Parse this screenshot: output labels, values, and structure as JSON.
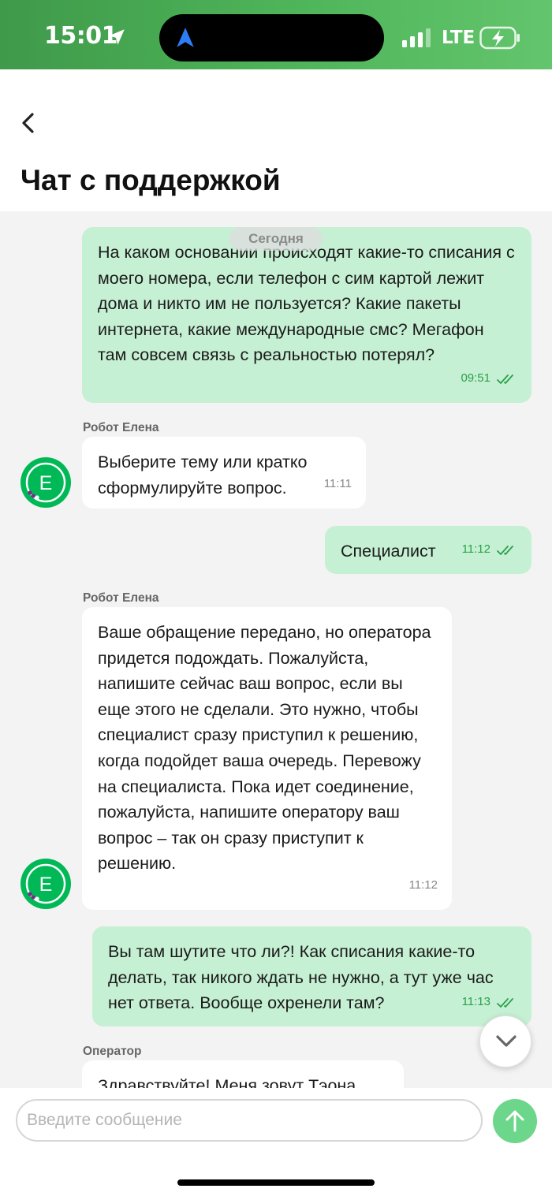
{
  "status_bar": {
    "time": "15:01",
    "network": "LTE"
  },
  "header": {
    "title": "Чат с поддержкой"
  },
  "chat": {
    "date_label": "Сегодня",
    "messages": [
      {
        "sender": "",
        "text": "На каком основании происходят какие-то списания с моего номера, если телефон с сим картой лежит дома и никто им не пользуется? Какие пакеты интернета, какие международные смс? Мегафон там совсем связь с реальностью потерял?",
        "time": "09:51",
        "read": true
      },
      {
        "sender": "Робот Елена",
        "text": "Выберите тему или кратко сформулируйте вопрос.",
        "time": "11:11",
        "avatar_letter": "Е"
      },
      {
        "sender": "",
        "text": "Специалист",
        "time": "11:12",
        "read": true
      },
      {
        "sender": "Робот Елена",
        "text": "Ваше обращение передано, но оператора придется подождать. Пожалуйста, напишите сейчас ваш вопрос, если вы еще этого не сделали. Это нужно, чтобы специалист сразу приступил к решению, когда подойдет ваша очередь. Перевожу на специалиста. Пока идет соединение, пожалуйста, напишите оператору ваш вопрос – так он сразу приступит к решению.",
        "time": "11:12",
        "avatar_letter": "Е"
      },
      {
        "sender": "",
        "text": "Вы там шутите что ли?! Как списания какие-то делать, так никого ждать не нужно, а тут уже час нет ответа. Вообще охренели там?",
        "time": "11:13",
        "read": true
      },
      {
        "sender": "Оператор",
        "text": "Здравствуйте! Меня зовут Тэона."
      }
    ]
  },
  "composer": {
    "placeholder": "Введите сообщение"
  },
  "colors": {
    "accent": "#00b956",
    "outgoing_bubble": "#c6f0d4",
    "incoming_bubble": "#ffffff",
    "send_button": "#6cd68a"
  },
  "icons": [
    "location-arrow-icon",
    "navigation-icon",
    "signal-icon",
    "battery-charging-icon",
    "back-chevron-icon",
    "read-ticks-icon",
    "avatar-logo-icon",
    "chevron-down-icon",
    "send-arrow-icon"
  ]
}
